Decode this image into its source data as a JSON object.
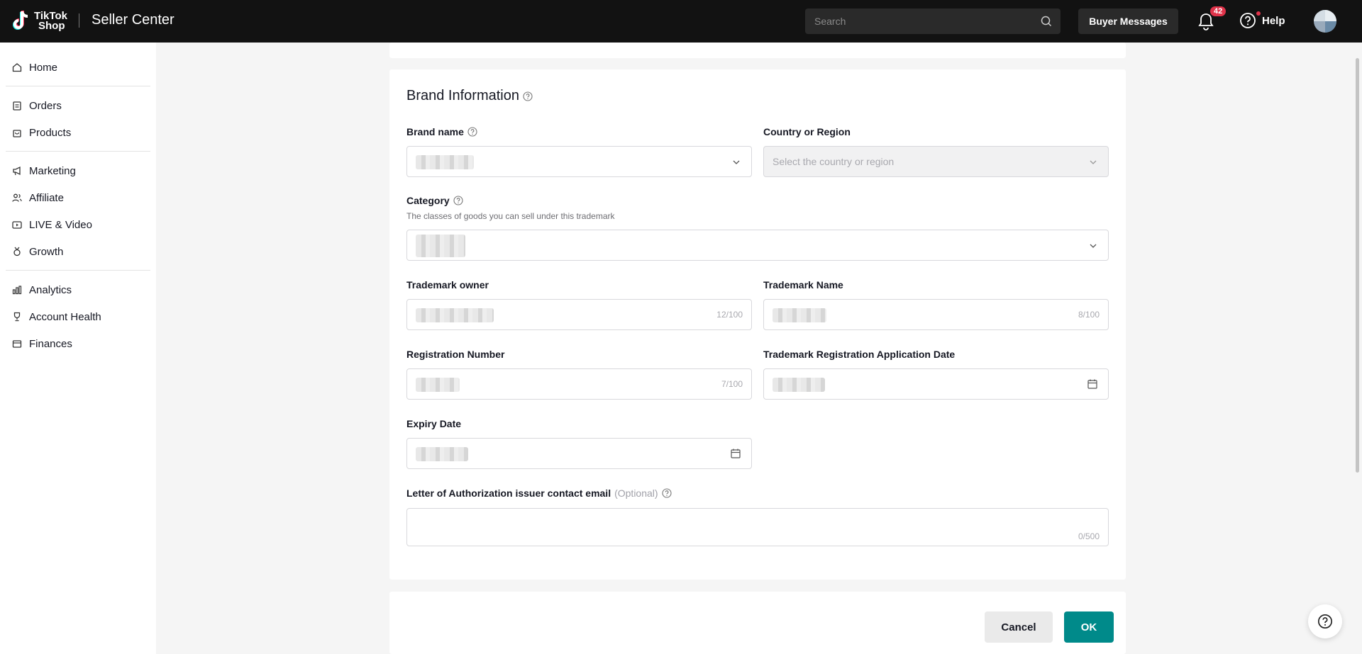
{
  "header": {
    "logo_line1": "TikTok",
    "logo_line2": "Shop",
    "title": "Seller Center",
    "search_placeholder": "Search",
    "buyer_messages": "Buyer Messages",
    "notification_count": "42",
    "help": "Help"
  },
  "sidebar": {
    "items": [
      {
        "label": "Home",
        "icon": "home-icon"
      },
      {
        "label": "Orders",
        "icon": "clipboard-icon"
      },
      {
        "label": "Products",
        "icon": "bag-icon"
      },
      {
        "label": "Marketing",
        "icon": "megaphone-icon"
      },
      {
        "label": "Affiliate",
        "icon": "users-icon"
      },
      {
        "label": "LIVE & Video",
        "icon": "video-icon"
      },
      {
        "label": "Growth",
        "icon": "medal-icon"
      },
      {
        "label": "Analytics",
        "icon": "chart-icon"
      },
      {
        "label": "Account Health",
        "icon": "trophy-icon"
      },
      {
        "label": "Finances",
        "icon": "wallet-icon"
      }
    ]
  },
  "form": {
    "section_title": "Brand Information",
    "brand_name_label": "Brand name",
    "country_label": "Country or Region",
    "country_placeholder": "Select the country or region",
    "category_label": "Category",
    "category_hint": "The classes of goods you can sell under this trademark",
    "trademark_owner_label": "Trademark owner",
    "trademark_owner_counter": "12/100",
    "trademark_name_label": "Trademark Name",
    "trademark_name_counter": "8/100",
    "registration_number_label": "Registration Number",
    "registration_number_counter": "7/100",
    "application_date_label": "Trademark Registration Application Date",
    "expiry_date_label": "Expiry Date",
    "email_label": "Letter of Authorization issuer contact email",
    "email_optional": "(Optional)",
    "email_counter": "0/500"
  },
  "actions": {
    "cancel": "Cancel",
    "ok": "OK"
  },
  "colors": {
    "topbar": "#121212",
    "primary": "#008a8a",
    "badge": "#e0334a"
  }
}
